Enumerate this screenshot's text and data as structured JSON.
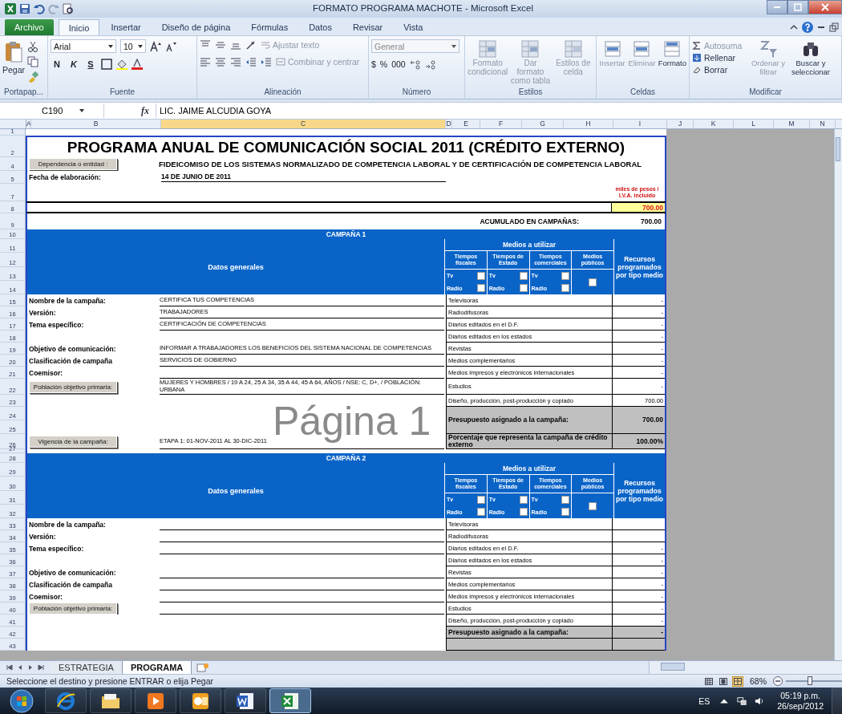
{
  "window": {
    "title": "FORMATO PROGRAMA MACHOTE - Microsoft Excel"
  },
  "ribbon": {
    "tabs": [
      {
        "label": "Archivo",
        "kind": "file",
        "selected": false
      },
      {
        "label": "Inicio",
        "kind": "tab",
        "selected": true
      },
      {
        "label": "Insertar",
        "kind": "tab",
        "selected": false
      },
      {
        "label": "Diseño de página",
        "kind": "tab",
        "selected": false
      },
      {
        "label": "Fórmulas",
        "kind": "tab",
        "selected": false
      },
      {
        "label": "Datos",
        "kind": "tab",
        "selected": false
      },
      {
        "label": "Revisar",
        "kind": "tab",
        "selected": false
      },
      {
        "label": "Vista",
        "kind": "tab",
        "selected": false
      }
    ],
    "clipboard": {
      "paste": "Pegar",
      "group": "Portapap..."
    },
    "font": {
      "name": "Arial",
      "size": "10",
      "styles": [
        "N",
        "K",
        "S"
      ],
      "group": "Fuente"
    },
    "alignment": {
      "wrap": {
        "label": "Ajustar texto",
        "disabled": true
      },
      "merge": {
        "label": "Combinar y centrar",
        "disabled": true
      },
      "group": "Alineación"
    },
    "number": {
      "format": "General",
      "format_disabled": true,
      "symbols": [
        "$",
        "%",
        "000"
      ],
      "group": "Número"
    },
    "styles": {
      "buttons": [
        {
          "label": "Formato condicional",
          "disabled": true
        },
        {
          "label": "Dar formato como tabla",
          "disabled": true
        },
        {
          "label": "Estilos de celda",
          "disabled": true
        }
      ],
      "group": "Estilos"
    },
    "cells": {
      "buttons": [
        {
          "label": "Insertar",
          "disabled": true
        },
        {
          "label": "Eliminar",
          "disabled": true
        },
        {
          "label": "Formato",
          "disabled": false
        }
      ],
      "group": "Celdas"
    },
    "editing": {
      "items": [
        {
          "label": "Autosuma",
          "disabled": true
        },
        {
          "label": "Rellenar",
          "disabled": false
        },
        {
          "label": "Borrar",
          "disabled": false
        }
      ],
      "buttons": [
        {
          "label": "Ordenar y filtrar",
          "disabled": true
        },
        {
          "label": "Buscar y seleccionar",
          "disabled": false
        }
      ],
      "group": "Modificar"
    }
  },
  "formula_bar": {
    "name_box": "C190",
    "function_label": "fx",
    "content": "LIC. JAIME ALCUDIA GOYA"
  },
  "column_headers": [
    {
      "label": "A",
      "selected": false
    },
    {
      "label": "B",
      "selected": false
    },
    {
      "label": "C",
      "selected": true
    },
    {
      "label": "D",
      "selected": false
    },
    {
      "label": "E",
      "selected": false
    },
    {
      "label": "F",
      "selected": false
    },
    {
      "label": "G",
      "selected": false
    },
    {
      "label": "H",
      "selected": false
    },
    {
      "label": "I",
      "selected": false
    },
    {
      "label": "J",
      "selected": false
    },
    {
      "label": "K",
      "selected": false
    },
    {
      "label": "L",
      "selected": false
    },
    {
      "label": "M",
      "selected": false
    },
    {
      "label": "N",
      "selected": false
    }
  ],
  "sheet": {
    "header_rows": [
      {
        "row": "1",
        "kind": "blank"
      },
      {
        "row": "2",
        "kind": "title",
        "text": "PROGRAMA ANUAL DE COMUNICACIÓN SOCIAL 2011  (CRÉDITO EXTERNO)"
      },
      {
        "row": "4",
        "kind": "dependencia",
        "button": "Dependencia o entidad :",
        "value": "FIDEICOMISO DE LOS SISTEMAS NORMALIZADO DE COMPETENCIA LABORAL Y DE CERTIFICACIÓN DE COMPETENCIA LABORAL"
      },
      {
        "row": "5",
        "kind": "fecha",
        "label": "Fecha de elaboración:",
        "value": "14 DE JUNIO DE 2011"
      },
      {
        "row": "7",
        "kind": "note",
        "lines": [
          "miles de pesos /",
          "I.V.A. incluido"
        ]
      },
      {
        "row": "8",
        "kind": "total",
        "value": "700.00"
      },
      {
        "row": "9",
        "kind": "acumulado",
        "label": "ACUMULADO EN CAMPAÑAS:",
        "value": "700.00"
      }
    ],
    "campaigns": [
      {
        "title_row": "10",
        "title": "CAMPAÑA 1",
        "header_rows": [
          "11",
          "12",
          "13",
          "14"
        ],
        "datos_header": "Datos generales",
        "medios_header": "Medios a utilizar",
        "recursos_header": "Recursos programados por tipo medio",
        "options": [
          {
            "label": "Tiempos fiscales",
            "checks": [
              {
                "label": "Tv",
                "checked": false
              },
              {
                "label": "Radio",
                "checked": false
              }
            ]
          },
          {
            "label": "Tiempos de Estado",
            "checks": [
              {
                "label": "Tv",
                "checked": false
              },
              {
                "label": "Radio",
                "checked": false
              }
            ]
          },
          {
            "label": "Tiempos comerciales",
            "checks": [
              {
                "label": "Tv",
                "checked": false
              },
              {
                "label": "Radio",
                "checked": false
              }
            ]
          },
          {
            "label": "Medios públicos",
            "checks": [
              {
                "checked": false
              }
            ]
          }
        ],
        "rows": [
          {
            "rows": [
              "15"
            ],
            "kind": "media",
            "field": "Nombre de la campaña:",
            "value": "CERTIFICA TUS COMPETENCIAS",
            "medio": "Televisoras",
            "amount": "-"
          },
          {
            "rows": [
              "16"
            ],
            "kind": "media",
            "field": "Versión:",
            "value": "TRABAJADORES",
            "medio": "Radiodifusoras",
            "amount": "-"
          },
          {
            "rows": [
              "17"
            ],
            "kind": "media",
            "field": "Tema específico:",
            "value": "CERTIFICACIÓN DE COMPETENCIAS",
            "medio": "Diarios editados en el D.F.",
            "amount": "-"
          },
          {
            "rows": [
              "18"
            ],
            "kind": "media",
            "medio": "Diarios editados en los estados",
            "amount": "-"
          },
          {
            "rows": [
              "19"
            ],
            "kind": "media",
            "field": "Objetivo de comunicación:",
            "value": "INFORMAR A TRABAJADORES LOS BENEFICIOS DEL SISTEMA NACIONAL DE COMPETENCIAS",
            "medio": "Revistas",
            "amount": "-"
          },
          {
            "rows": [
              "20"
            ],
            "kind": "media",
            "field": "Clasificación de campaña",
            "value": "SERVICIOS DE GOBIERNO",
            "medio": "Medios complementarios",
            "amount": "-"
          },
          {
            "rows": [
              "21"
            ],
            "kind": "media",
            "field": "Coemisor:",
            "medio": "Medios impresos y electrónicos internacionales",
            "amount": "-"
          },
          {
            "rows": [
              "22"
            ],
            "kind": "media",
            "button": "Población objetivo primaria:",
            "value": "MUJERES Y HOMBRES / 19 A 24, 25 A 34, 35 A 44, 45 A 64,  AÑOS / NSE: C, D+,  / POBLACIÓN: URBANA",
            "medio": "Estudios",
            "amount": "-"
          },
          {
            "rows": [
              "23"
            ],
            "kind": "media",
            "medio": "Diseño, producción, post-producción y copiado",
            "amount": "700.00"
          },
          {
            "rows": [
              "24",
              "25"
            ],
            "kind": "total",
            "medio": "Presupuesto asignado a la campaña:",
            "amount": "700.00"
          },
          {
            "rows": [
              "26"
            ],
            "kind": "total",
            "button": "Vigencia de la campaña:",
            "value": "ETAPA 1: 01-NOV-2011 AL 30-DIC-2011",
            "medio": "Porcentaje que representa la campaña de crédito externo",
            "amount": "100.00%"
          }
        ],
        "gap_row": "27"
      },
      {
        "title_row": "28",
        "title": "CAMPAÑA 2",
        "header_rows": [
          "29",
          "30",
          "31",
          "32"
        ],
        "datos_header": "Datos generales",
        "medios_header": "Medios a utilizar",
        "recursos_header": "Recursos programados por tipo medio",
        "options": [
          {
            "label": "Tiempos fiscales",
            "checks": [
              {
                "label": "Tv",
                "checked": false
              },
              {
                "label": "Radio",
                "checked": false
              }
            ]
          },
          {
            "label": "Tiempos de Estado",
            "checks": [
              {
                "label": "Tv",
                "checked": false
              },
              {
                "label": "Radio",
                "checked": false
              }
            ]
          },
          {
            "label": "Tiempos comerciales",
            "checks": [
              {
                "label": "Tv",
                "checked": false
              },
              {
                "label": "Radio",
                "checked": false
              }
            ]
          },
          {
            "label": "Medios públicos",
            "checks": [
              {
                "checked": false
              }
            ]
          }
        ],
        "rows": [
          {
            "rows": [
              "33"
            ],
            "kind": "media",
            "field": "Nombre de la campaña:",
            "medio": "Televisoras"
          },
          {
            "rows": [
              "34"
            ],
            "kind": "media",
            "field": "Versión:",
            "medio": "Radiodifusoras"
          },
          {
            "rows": [
              "35"
            ],
            "kind": "media",
            "field": "Tema específico:",
            "medio": "Diarios editados en el D.F.",
            "amount": "-"
          },
          {
            "rows": [
              "36"
            ],
            "kind": "media",
            "medio": "Diarios editados en los estados",
            "amount": "-"
          },
          {
            "rows": [
              "37"
            ],
            "kind": "media",
            "field": "Objetivo de comunicación:",
            "medio": "Revistas",
            "amount": "-"
          },
          {
            "rows": [
              "38"
            ],
            "kind": "media",
            "field": "Clasificación de campaña",
            "medio": "Medios complementarios",
            "amount": "-"
          },
          {
            "rows": [
              "39"
            ],
            "kind": "media",
            "field": "Coemisor:",
            "medio": "Medios impresos y electrónicos internacionales",
            "amount": "-"
          },
          {
            "rows": [
              "40"
            ],
            "kind": "media",
            "button": "Población objetivo primaria:",
            "medio": "Estudios",
            "amount": "-"
          },
          {
            "rows": [
              "41"
            ],
            "kind": "media",
            "medio": "Diseño, producción, post-producción y copiado",
            "amount": "-"
          },
          {
            "rows": [
              "42"
            ],
            "kind": "total",
            "medio": "Presupuesto asignado a la campaña:",
            "amount": "-"
          },
          {
            "rows": [
              "43"
            ],
            "kind": "total"
          }
        ]
      }
    ],
    "page_watermark": "Página 1"
  },
  "sheet_tabs": [
    {
      "label": "ESTRATEGIA",
      "selected": false
    },
    {
      "label": "PROGRAMA",
      "selected": true
    }
  ],
  "status_bar": {
    "message": "Seleccione el destino y presione ENTRAR o elija Pegar",
    "views": [
      {
        "selected": false
      },
      {
        "selected": false
      },
      {
        "selected": true
      }
    ],
    "zoom": "68%",
    "level": 0.38
  },
  "taskbar": {
    "apps": [
      {
        "kind": "browser",
        "selected": false
      },
      {
        "kind": "folder",
        "selected": false
      },
      {
        "kind": "media",
        "selected": false
      },
      {
        "kind": "mail",
        "selected": false
      },
      {
        "kind": "word",
        "selected": false
      },
      {
        "kind": "excel",
        "selected": true
      }
    ],
    "language": "ES",
    "time": "05:19 p.m.",
    "date": "26/sep/2012"
  }
}
